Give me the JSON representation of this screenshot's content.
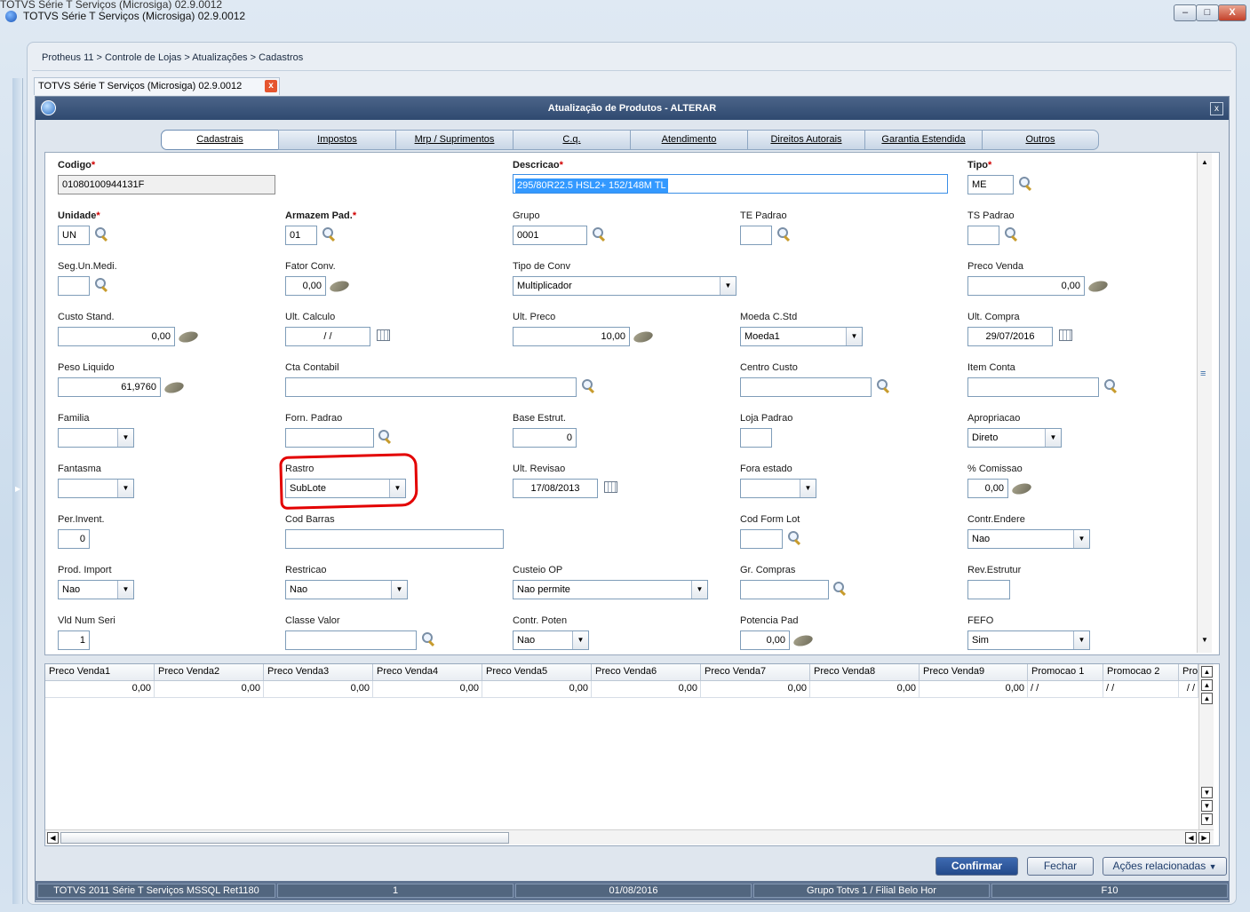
{
  "caption": "TOTVS Série T Serviços (Microsiga) 02.9.0012",
  "window": {
    "title": "TOTVS Série T Serviços (Microsiga) 02.9.0012",
    "minimize": "–",
    "maximize": "□",
    "close": "X"
  },
  "breadcrumb": "Protheus 11 > Controle de Lojas > Atualizações > Cadastros",
  "doc_tab": {
    "label": "TOTVS Série T Serviços (Microsiga) 02.9.0012",
    "close": "x"
  },
  "dialog": {
    "title": "Atualização de Produtos - ALTERAR",
    "close": "x"
  },
  "tabs": [
    "Cadastrais",
    "Impostos",
    "Mrp / Suprimentos",
    "C.q.",
    "Atendimento",
    "Direitos Autorais",
    "Garantia Estendida",
    "Outros"
  ],
  "form": {
    "codigo": {
      "label": "Codigo",
      "value": "01080100944131F"
    },
    "descricao": {
      "label": "Descricao",
      "value": "295/80R22.5 HSL2+ 152/148M TL"
    },
    "tipo": {
      "label": "Tipo",
      "value": "ME"
    },
    "unidade": {
      "label": "Unidade",
      "value": "UN"
    },
    "armazem": {
      "label": "Armazem Pad.",
      "value": "01"
    },
    "grupo": {
      "label": "Grupo",
      "value": "0001"
    },
    "te_padrao": {
      "label": "TE Padrao",
      "value": ""
    },
    "ts_padrao": {
      "label": "TS Padrao",
      "value": ""
    },
    "seg_un": {
      "label": "Seg.Un.Medi.",
      "value": ""
    },
    "fator_conv": {
      "label": "Fator Conv.",
      "value": "0,00"
    },
    "tipo_conv": {
      "label": "Tipo de Conv",
      "value": "Multiplicador"
    },
    "preco_venda": {
      "label": "Preco Venda",
      "value": "0,00"
    },
    "custo_stand": {
      "label": "Custo Stand.",
      "value": "0,00"
    },
    "ult_calculo": {
      "label": "Ult. Calculo",
      "value": "/ /"
    },
    "ult_preco": {
      "label": "Ult. Preco",
      "value": "10,00"
    },
    "moeda": {
      "label": "Moeda C.Std",
      "value": "Moeda1"
    },
    "ult_compra": {
      "label": "Ult. Compra",
      "value": "29/07/2016"
    },
    "peso_liquido": {
      "label": "Peso Liquido",
      "value": "61,9760"
    },
    "cta_contabil": {
      "label": "Cta Contabil",
      "value": ""
    },
    "centro_custo": {
      "label": "Centro Custo",
      "value": ""
    },
    "item_conta": {
      "label": "Item Conta",
      "value": ""
    },
    "familia": {
      "label": "Familia",
      "value": ""
    },
    "forn_padrao": {
      "label": "Forn. Padrao",
      "value": ""
    },
    "base_estrut": {
      "label": "Base Estrut.",
      "value": "0"
    },
    "loja_padrao": {
      "label": "Loja Padrao",
      "value": ""
    },
    "apropriacao": {
      "label": "Apropriacao",
      "value": "Direto"
    },
    "fantasma": {
      "label": "Fantasma",
      "value": ""
    },
    "rastro": {
      "label": "Rastro",
      "value": "SubLote"
    },
    "ult_revisao": {
      "label": "Ult. Revisao",
      "value": "17/08/2013"
    },
    "fora_estado": {
      "label": "Fora estado",
      "value": ""
    },
    "comissao": {
      "label": "% Comissao",
      "value": "0,00"
    },
    "per_invent": {
      "label": "Per.Invent.",
      "value": "0"
    },
    "cod_barras": {
      "label": "Cod Barras",
      "value": ""
    },
    "cod_form_lot": {
      "label": "Cod Form Lot",
      "value": ""
    },
    "contr_endere": {
      "label": "Contr.Endere",
      "value": "Nao"
    },
    "prod_import": {
      "label": "Prod. Import",
      "value": "Nao"
    },
    "restricao": {
      "label": "Restricao",
      "value": "Nao"
    },
    "custeio_op": {
      "label": "Custeio OP",
      "value": "Nao permite"
    },
    "gr_compras": {
      "label": "Gr. Compras",
      "value": ""
    },
    "rev_estrutur": {
      "label": "Rev.Estrutur",
      "value": ""
    },
    "vld_num_seri": {
      "label": "Vld Num Seri",
      "value": "1"
    },
    "classe_valor": {
      "label": "Classe Valor",
      "value": ""
    },
    "contr_poten": {
      "label": "Contr. Poten",
      "value": "Nao"
    },
    "potencia_pad": {
      "label": "Potencia Pad",
      "value": "0,00"
    },
    "fefo": {
      "label": "FEFO",
      "value": "Sim"
    },
    "required_mark": "*"
  },
  "grid": {
    "columns": [
      "Preco Venda1",
      "Preco Venda2",
      "Preco Venda3",
      "Preco Venda4",
      "Preco Venda5",
      "Preco Venda6",
      "Preco Venda7",
      "Preco Venda8",
      "Preco Venda9",
      "Promocao 1",
      "Promocao 2",
      "Pro"
    ],
    "row": [
      "0,00",
      "0,00",
      "0,00",
      "0,00",
      "0,00",
      "0,00",
      "0,00",
      "0,00",
      "0,00",
      "/ /",
      "/ /",
      "/ /"
    ]
  },
  "buttons": {
    "confirm": "Confirmar",
    "close": "Fechar",
    "actions": "Ações relacionadas"
  },
  "status": [
    "TOTVS 2011 Série T Serviços MSSQL Ret1180",
    "1",
    "01/08/2016",
    "Grupo Totvs 1 / Filial Belo Hor",
    "F10"
  ],
  "colors": {
    "highlight": "#e30000",
    "title_bar": "#2f4a70",
    "selection": "#3399ff"
  }
}
